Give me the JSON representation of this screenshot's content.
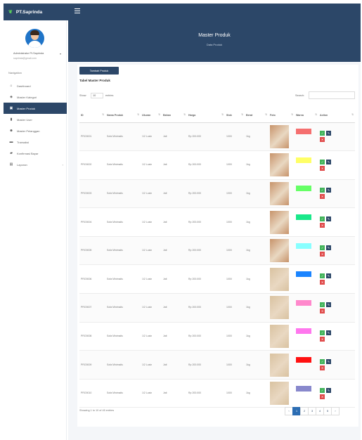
{
  "app": {
    "brand": "PT.Saprinda"
  },
  "sidebar": {
    "user_name": "Administrator Pt.Saprinda",
    "user_email": "saprinda@gmail.com",
    "nav_heading": "Navigation",
    "items": [
      {
        "label": "Dashboard",
        "icon": "home-icon",
        "glyph": "⌂"
      },
      {
        "label": "Master Kategori",
        "icon": "tag-icon",
        "glyph": "◈"
      },
      {
        "label": "Master Produk",
        "icon": "box-icon",
        "glyph": "▣",
        "active": true
      },
      {
        "label": "Master User",
        "icon": "user-icon",
        "glyph": "▮"
      },
      {
        "label": "Master Pelanggan",
        "icon": "users-icon",
        "glyph": "☻"
      },
      {
        "label": "Transaksi",
        "icon": "cart-icon",
        "glyph": "▬"
      },
      {
        "label": "Konfirmasi Bayar",
        "icon": "truck-icon",
        "glyph": "▰"
      },
      {
        "label": "Laporan",
        "icon": "file-icon",
        "glyph": "▤",
        "has_submenu": true
      }
    ]
  },
  "header": {
    "title": "Master Produk",
    "subtitle": "Data Produk"
  },
  "card": {
    "add_button": "Tambah Produk",
    "title": "Tabel Master Produk",
    "show_label": "Show",
    "show_value": "10",
    "entries_label": "entries",
    "search_label": "Search:",
    "search_value": ""
  },
  "table": {
    "columns": [
      "ID",
      "Nama Produk",
      "Ukuran",
      "Bahan",
      "Harga",
      "Stok",
      "Berat",
      "Foto",
      "Warna",
      "Action"
    ],
    "rows": [
      {
        "id": "PRO0001",
        "nama": "Sofa Minimalis",
        "ukuran": "1/2 Lusin",
        "bahan": "Jati",
        "harga": "Rp 200.000",
        "stok": "1000",
        "berat": "1kg",
        "warna": "#f56f6f",
        "wood": "#c7936a"
      },
      {
        "id": "PRO0002",
        "nama": "Sofa Minimalis",
        "ukuran": "1/2 Lusin",
        "bahan": "Jati",
        "harga": "Rp 200.000",
        "stok": "1000",
        "berat": "1kg",
        "warna": "#ffff66",
        "wood": "#c7936a"
      },
      {
        "id": "PRO0003",
        "nama": "Sofa Minimalis",
        "ukuran": "1/2 Lusin",
        "bahan": "Jati",
        "harga": "Rp 200.000",
        "stok": "1000",
        "berat": "1kg",
        "warna": "#66ff66",
        "wood": "#c7936a"
      },
      {
        "id": "PRO0004",
        "nama": "Sofa Minimalis",
        "ukuran": "1/2 Lusin",
        "bahan": "Jati",
        "harga": "Rp 200.000",
        "stok": "1000",
        "berat": "1kg",
        "warna": "#19e88a",
        "wood": "#c7936a"
      },
      {
        "id": "PRO0005",
        "nama": "Sofa Minimalis",
        "ukuran": "1/2 Lusin",
        "bahan": "Jati",
        "harga": "Rp 200.000",
        "stok": "1000",
        "berat": "1kg",
        "warna": "#88ffff",
        "wood": "#c7936a"
      },
      {
        "id": "PRO0006",
        "nama": "Sofa Minimalis",
        "ukuran": "1/2 Lusin",
        "bahan": "Jati",
        "harga": "Rp 200.000",
        "stok": "1000",
        "berat": "1kg",
        "warna": "#1a84ff",
        "wood": "#d9c2a0"
      },
      {
        "id": "PRO0007",
        "nama": "Sofa Minimalis",
        "ukuran": "1/2 Lusin",
        "bahan": "Jati",
        "harga": "Rp 200.000",
        "stok": "1000",
        "berat": "1kg",
        "warna": "#ff88cc",
        "wood": "#d9c2a0"
      },
      {
        "id": "PRO0008",
        "nama": "Sofa Minimalis",
        "ukuran": "1/2 Lusin",
        "bahan": "Jati",
        "harga": "Rp 200.000",
        "stok": "1000",
        "berat": "1kg",
        "warna": "#ff77ee",
        "wood": "#d9c2a0"
      },
      {
        "id": "PRO0009",
        "nama": "Sofa Minimalis",
        "ukuran": "1/2 Lusin",
        "bahan": "Jati",
        "harga": "Rp 200.000",
        "stok": "1000",
        "berat": "1kg",
        "warna": "#ff1111",
        "wood": "#d9c2a0"
      },
      {
        "id": "PRO0010",
        "nama": "Sofa Minimalis",
        "ukuran": "1/2 Lusin",
        "bahan": "Jati",
        "harga": "Rp 200.000",
        "stok": "1000",
        "berat": "1kg",
        "warna": "#8888cc",
        "wood": "#d9c2a0"
      }
    ]
  },
  "footer": {
    "info": "Showing 1 to 10 of 45 entries",
    "pages": [
      "‹",
      "1",
      "2",
      "3",
      "4",
      "5",
      "›"
    ],
    "current_page": "1"
  },
  "colors": {
    "primary": "#2c4768",
    "view": "#42b35a",
    "delete": "#e04b4b"
  }
}
